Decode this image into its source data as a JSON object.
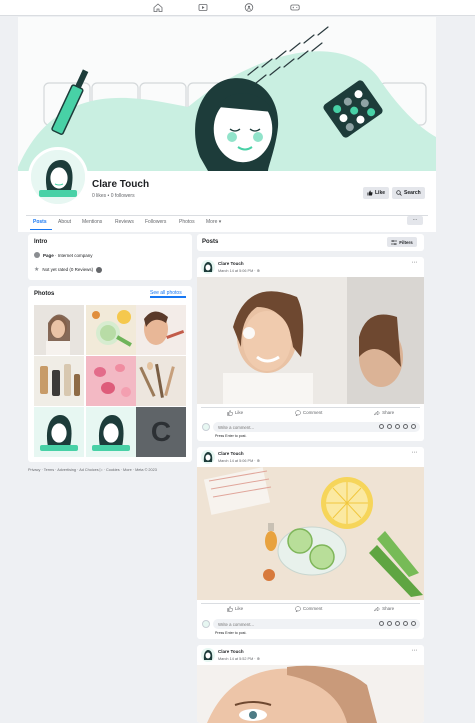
{
  "nav": {
    "icons": [
      "home-icon",
      "video-icon",
      "groups-icon",
      "gaming-icon"
    ]
  },
  "page": {
    "name": "Clare Touch",
    "stats": "0 likes • 0 followers",
    "like_label": "Like",
    "search_label": "Search",
    "more_label": "···"
  },
  "tabs": [
    {
      "label": "Posts",
      "active": true
    },
    {
      "label": "About"
    },
    {
      "label": "Mentions"
    },
    {
      "label": "Reviews"
    },
    {
      "label": "Followers"
    },
    {
      "label": "Photos"
    },
    {
      "label": "More ▾"
    }
  ],
  "intro": {
    "title": "Intro",
    "page_prefix": "Page",
    "category": " · Internet company",
    "rating": "Not yet rated (0 Reviews)"
  },
  "photos": {
    "title": "Photos",
    "see_all": "See all photos",
    "letter_tile": "C"
  },
  "footer": "Privacy · Terms · Advertising · Ad Choices ▷ · Cookies · More · Meta © 2023",
  "posts_section": {
    "title": "Posts",
    "filters_label": "Filters"
  },
  "posts": [
    {
      "author": "Clare Touch",
      "date": "March 14 at 5:06 PM · ⊕"
    },
    {
      "author": "Clare Touch",
      "date": "March 14 at 5:06 PM · ⊕"
    },
    {
      "author": "Clare Touch",
      "date": "March 14 at 5:52 PM · ⊕"
    }
  ],
  "actions": {
    "like": "Like",
    "comment": "Comment",
    "share": "Share",
    "comment_placeholder": "Write a comment...",
    "press_enter": "Press Enter to post."
  },
  "colors": {
    "accent": "#1877f2",
    "brand_mint": "#48d1a6",
    "background": "#eef0f3"
  }
}
